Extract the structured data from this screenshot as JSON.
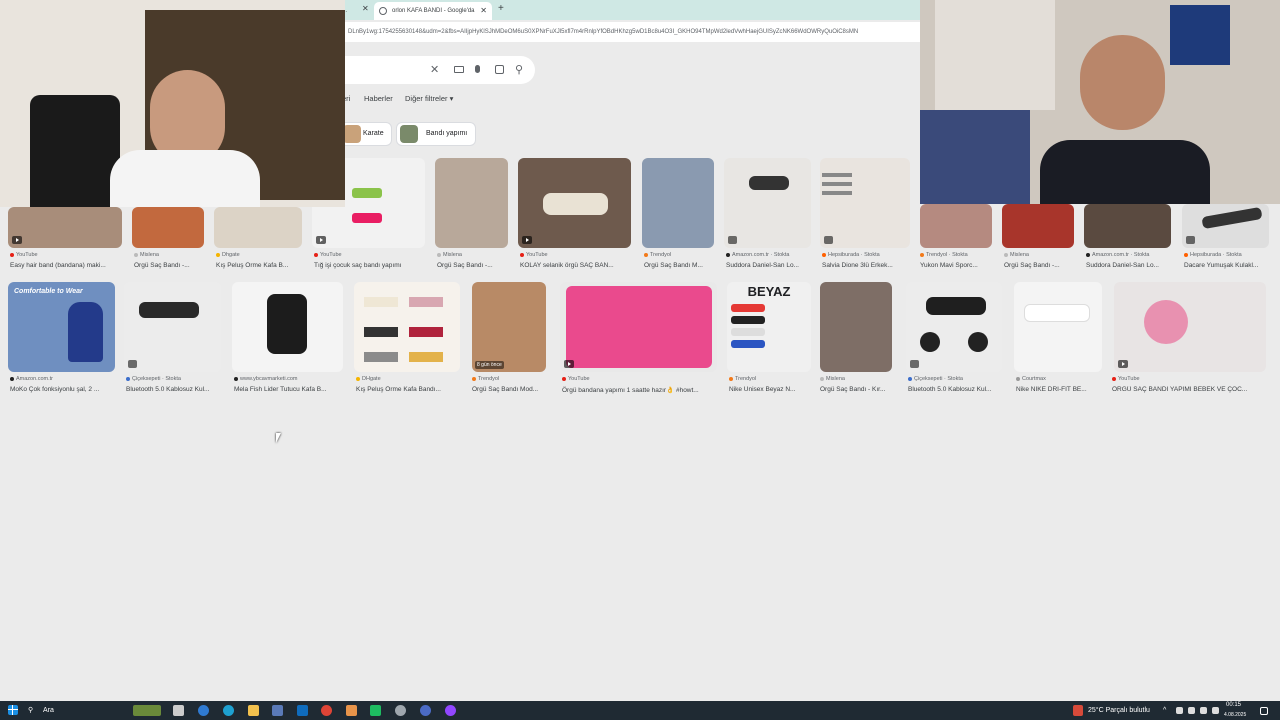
{
  "browser": {
    "prev_tab": "...",
    "active_tab": "orlon KAFA BANDI - Google'da",
    "address": "DLnBy1wg:1754255630148&udm=2&fbs=AIIjpHyKlSJhMDeOM6uS0XPNrFuXJl5xfl7m4rRnlpYfOBdHKhzg5wD1Bc8u4O3I_GKHO94TMpWd2ledVwhHaejGUISyZcNK66WdOWRyQuOiC8sMN"
  },
  "search": {
    "clear_icon": "close-icon",
    "keyboard_icon": "keyboard-icon",
    "mic_icon": "mic-icon",
    "lens_icon": "lens-icon",
    "search_icon": "search-icon"
  },
  "nav": {
    "items_partial": "eri",
    "news": "Haberler",
    "more_filters": "Diğer filtreler"
  },
  "chips": [
    {
      "label": "Karate"
    },
    {
      "label": "Bandı yapımı"
    }
  ],
  "row1": [
    {
      "source": "",
      "caption": ""
    },
    {
      "source": "",
      "caption": ""
    },
    {
      "source": "",
      "caption": ""
    },
    {
      "source": "",
      "caption": ""
    },
    {
      "source": "",
      "caption": ""
    },
    {
      "source": "",
      "caption": ""
    },
    {
      "source": "",
      "caption": ""
    }
  ],
  "row2": [
    {
      "source": "YouTube",
      "caption": "Easy hair band (bandana) maki..."
    },
    {
      "source": "Mislena",
      "caption": "Örgü Saç Bandı -..."
    },
    {
      "source": "Dhgate",
      "caption": "Kış Peluş Örme Kafa B..."
    },
    {
      "source": "YouTube",
      "caption": "Tığ işi çocuk saç bandı yapımı"
    },
    {
      "source": "Mislena",
      "caption": "Örgü Saç Bandı -..."
    },
    {
      "source": "YouTube",
      "caption": "KOLAY selanik örgü SAÇ BAN..."
    },
    {
      "source": "Trendyol",
      "caption": "Örgü Saç Bandı M..."
    },
    {
      "source": "Amazon.com.tr · Stokta",
      "caption": "Suddora Daniel-San Lo..."
    },
    {
      "source": "Hepsiburada · Stokta",
      "caption": "Salvia Dione 3lü Erkek..."
    },
    {
      "source": "Trendyol · Stokta",
      "caption": "Yukon Mavi Sporc..."
    },
    {
      "source": "Mislena",
      "caption": "Örgü Saç Bandı -..."
    },
    {
      "source": "Amazon.com.tr · Stokta",
      "caption": "Suddora Daniel-San Lo..."
    },
    {
      "source": "Hepsiburada · Stokta",
      "caption": "Dacare Yumuşak Kulakl..."
    }
  ],
  "row3": [
    {
      "source": "Amazon.com.tr",
      "caption": "MoKo Çok fonksiyonlu şal, 2 ...",
      "overlay": "Comfortable to Wear"
    },
    {
      "source": "Çiçeksepeti · Stokta",
      "caption": "Bluetooth 5.0 Kablosuz Kul..."
    },
    {
      "source": "www.ybcavmarketi.com",
      "caption": "Mela Fish Lider Tutucu Kafa B..."
    },
    {
      "source": "DHgate",
      "caption": "Kış Peluş Örme Kafa Bandı..."
    },
    {
      "source": "Trendyol",
      "caption": "Örgü Saç Bandı Mod...",
      "overlay": "8 gün önce"
    },
    {
      "source": "YouTube",
      "caption": "Örgü bandana yapımı 1 saatte hazır👌 #howt..."
    },
    {
      "source": "Trendyol",
      "caption": "Nike Unisex Beyaz N...",
      "overlay": "BEYAZ"
    },
    {
      "source": "Mislena",
      "caption": "Örgü Saç Bandı - Kır..."
    },
    {
      "source": "Çiçeksepeti · Stokta",
      "caption": "Bluetooth 5.0 Kablosuz Kul..."
    },
    {
      "source": "Courtmax",
      "caption": "Nike NIKE DRI-FIT BE..."
    },
    {
      "source": "YouTube",
      "caption": "ÖRGÜ SAÇ BANDI YAPIMI BEBEK VE ÇOC..."
    }
  ],
  "taskbar": {
    "search_label": "Ara",
    "weather": "25°C  Parçalı bulutlu",
    "time": "00:15",
    "date": "4.08.2025"
  },
  "colors": {
    "youtube": "#e62117",
    "trendyol": "#f27a1a",
    "amazon": "#222222",
    "hepsiburada": "#ff6000",
    "mislena": "#bbbbbb",
    "dhgate": "#f5b400",
    "ciceksepeti": "#3c6ecb"
  }
}
